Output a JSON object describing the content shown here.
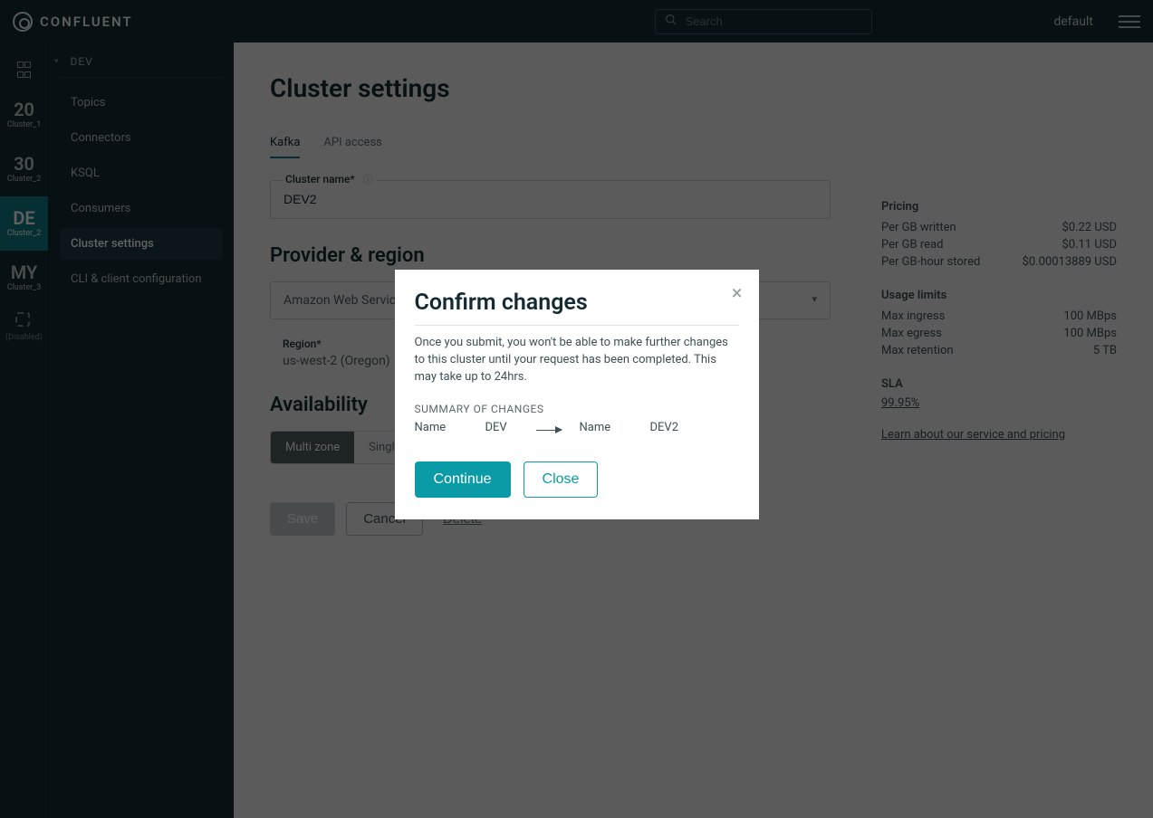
{
  "brand": {
    "name": "CONFLUENT"
  },
  "topbar": {
    "search_placeholder": "Search",
    "account_label": "default"
  },
  "rail": {
    "items": [
      {
        "big": "20",
        "sub": "Cluster_1"
      },
      {
        "big": "30",
        "sub": "Cluster_2"
      },
      {
        "big": "DE",
        "sub": "Cluster_2",
        "active": true
      },
      {
        "big": "MY",
        "sub": "Cluster_3"
      }
    ],
    "add_label": "(Disabled)"
  },
  "sidebar": {
    "section": "DEV",
    "items": [
      {
        "label": "Topics"
      },
      {
        "label": "Connectors"
      },
      {
        "label": "KSQL"
      },
      {
        "label": "Consumers"
      },
      {
        "label": "Cluster settings",
        "active": true
      },
      {
        "label": "CLI & client configuration"
      }
    ]
  },
  "page": {
    "title": "Cluster settings",
    "tabs": [
      {
        "label": "Kafka",
        "active": true
      },
      {
        "label": "API access"
      }
    ],
    "cluster_name_label": "Cluster name*",
    "cluster_name_value": "DEV2",
    "provider_region_header": "Provider & region",
    "provider_value": "Amazon Web Services",
    "region_label": "Region*",
    "region_value": "us-west-2 (Oregon)",
    "availability_header": "Availability",
    "seg": [
      {
        "label": "Multi zone",
        "active": true
      },
      {
        "label": "Single zone"
      }
    ],
    "save_label": "Save",
    "cancel_label": "Cancel",
    "delete_label": "Delete"
  },
  "pricing": {
    "title": "Pricing",
    "rows": [
      {
        "k": "Per GB written",
        "v": "$0.22 USD"
      },
      {
        "k": "Per GB read",
        "v": "$0.11 USD"
      },
      {
        "k": "Per GB-hour stored",
        "v": "$0.00013889 USD"
      }
    ]
  },
  "usage": {
    "title": "Usage limits",
    "rows": [
      {
        "k": "Max ingress",
        "v": "100 MBps"
      },
      {
        "k": "Max egress",
        "v": "100 MBps"
      },
      {
        "k": "Max retention",
        "v": "5 TB"
      }
    ]
  },
  "sla": {
    "title": "SLA",
    "value": "99.95%"
  },
  "learn_more": "Learn about our service and pricing",
  "modal": {
    "title": "Confirm changes",
    "body": "Once you submit, you won't be able to make further changes to this cluster until your request has been completed. This may take up to 24hrs.",
    "summary_label": "SUMMARY OF CHANGES",
    "from_key": "Name",
    "from_val": "DEV",
    "to_key": "Name",
    "to_val": "DEV2",
    "continue_label": "Continue",
    "close_label": "Close"
  }
}
